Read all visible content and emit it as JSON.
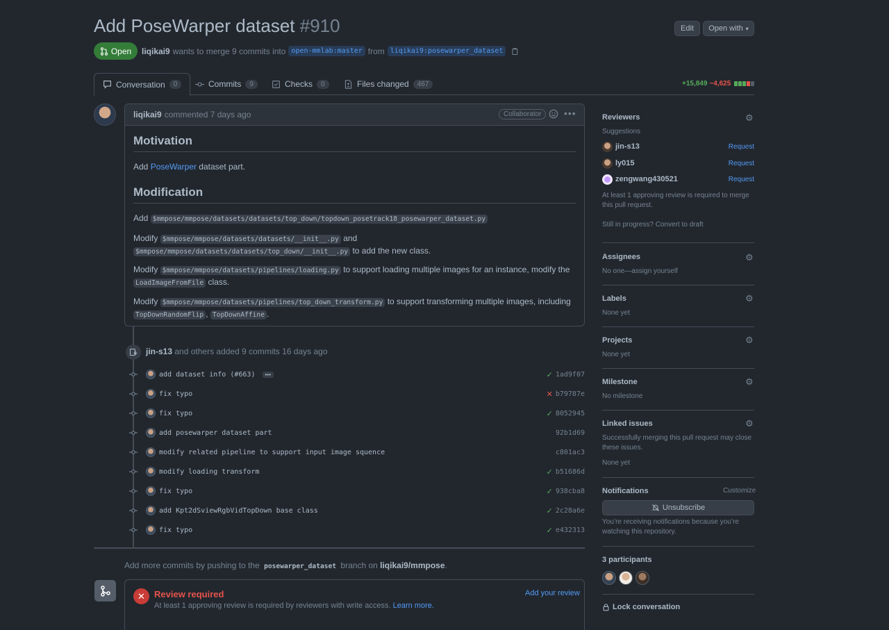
{
  "header": {
    "title": "Add PoseWarper dataset",
    "number": "#910",
    "edit_label": "Edit",
    "open_with_label": "Open with",
    "state_label": "Open",
    "author": "liqikai9",
    "merge_text": "wants to merge 9 commits into",
    "base_branch": "open-mmlab:master",
    "from_text": "from",
    "head_branch": "liqikai9:posewarper_dataset"
  },
  "tabs": [
    {
      "label": "Conversation",
      "count": "0"
    },
    {
      "label": "Commits",
      "count": "9"
    },
    {
      "label": "Checks",
      "count": "0"
    },
    {
      "label": "Files changed",
      "count": "467"
    }
  ],
  "diffstat": {
    "additions": "+15,849",
    "deletions": "−4,625"
  },
  "comment": {
    "author": "liqikai9",
    "action": "commented 7 days ago",
    "badge": "Collaborator",
    "h_motivation": "Motivation",
    "motivation_pre": "Add",
    "motivation_link": "PoseWarper",
    "motivation_post": "dataset part.",
    "h_modification": "Modification",
    "p1_pre": "Add",
    "p1_code": "$mmpose/mmpose/datasets/datasets/top_down/topdown_posetrack18_posewarper_dataset.py",
    "p2_pre": "Modify",
    "p2_code1": "$mmpose/mmpose/datasets/datasets/__init__.py",
    "p2_mid": "and",
    "p2_code2": "$mmpose/mmpose/datasets/datasets/top_down/__init__.py",
    "p2_post": "to add the new class.",
    "p3_pre": "Modify",
    "p3_code1": "$mmpose/mmpose/datasets/pipelines/loading.py",
    "p3_mid": "to support loading multiple images for an instance, modify the",
    "p3_code2": "LoadImageFromFile",
    "p3_post": "class.",
    "p4_pre": "Modify",
    "p4_code1": "$mmpose/mmpose/datasets/pipelines/top_down_transform.py",
    "p4_mid": "to support transforming multiple images, including",
    "p4_code2": "TopDownRandomFlip",
    "p4_comma": ",",
    "p4_code3": "TopDownAffine",
    "p4_end": "."
  },
  "event": {
    "actor": "jin-s13",
    "text": "and others added 9 commits 16 days ago"
  },
  "commits": [
    {
      "message": "add dataset info (",
      "link": "#663",
      "suffix": ")",
      "status": "ok",
      "sha": "1ad9f07"
    },
    {
      "message": "fix typo",
      "status": "fail",
      "sha": "b79787e"
    },
    {
      "message": "fix typo",
      "status": "ok",
      "sha": "8052945"
    },
    {
      "message": "add posewarper dataset part",
      "status": "none",
      "sha": "92b1d69"
    },
    {
      "message": "modify related pipeline to support input image squence",
      "status": "none",
      "sha": "c801ac3"
    },
    {
      "message": "modify loading transform",
      "status": "ok",
      "sha": "b51686d"
    },
    {
      "message": "fix typo",
      "status": "ok",
      "sha": "938cba8"
    },
    {
      "message": "add Kpt2dSviewRgbVidTopDown base class",
      "status": "ok",
      "sha": "2c28a6e"
    },
    {
      "message": "fix typo",
      "status": "ok",
      "sha": "e432313"
    }
  ],
  "push_msg": {
    "pre": "Add more commits by pushing to the",
    "branch": "posewarper_dataset",
    "mid": "branch on",
    "repo": "liqikai9/mmpose",
    "end": "."
  },
  "merge": {
    "title": "Review required",
    "subtitle": "At least 1 approving review is required by reviewers with write access.",
    "learn_more": "Learn more.",
    "add_review": "Add your review"
  },
  "sidebar": {
    "reviewers_title": "Reviewers",
    "suggestions_label": "Suggestions",
    "reviewers": [
      {
        "name": "jin-s13",
        "action": "Request"
      },
      {
        "name": "ly015",
        "action": "Request"
      },
      {
        "name": "zengwang430521",
        "action": "Request"
      }
    ],
    "reviewers_note": "At least 1 approving review is required to merge this pull request.",
    "draft_note": "Still in progress? Convert to draft",
    "assignees_title": "Assignees",
    "assignees_value": "No one—assign yourself",
    "labels_title": "Labels",
    "labels_value": "None yet",
    "projects_title": "Projects",
    "projects_value": "None yet",
    "milestone_title": "Milestone",
    "milestone_value": "No milestone",
    "linked_title": "Linked issues",
    "linked_note": "Successfully merging this pull request may close these issues.",
    "linked_value": "None yet",
    "notifications_title": "Notifications",
    "customize_label": "Customize",
    "unsubscribe_label": "Unsubscribe",
    "notifications_note": "You’re receiving notifications because you’re watching this repository.",
    "participants_title": "3 participants",
    "lock_label": "Lock conversation"
  },
  "colors": {
    "accent": "#539bf5",
    "open_green": "#347d39",
    "danger": "#e5534b",
    "success": "#57ab5a"
  }
}
